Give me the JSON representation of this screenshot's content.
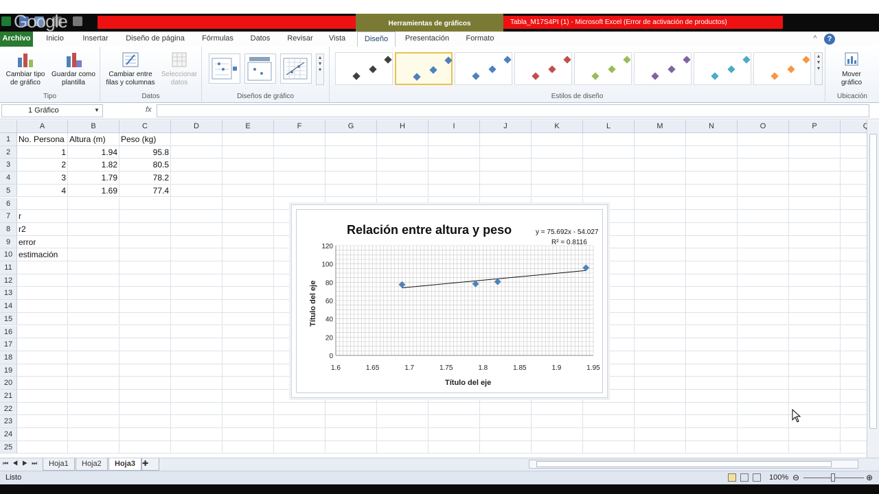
{
  "titlebar": {
    "tools_label": "Herramientas de gráficos",
    "window_title": "Tabla_M17S4PI (1)  -  Microsoft Excel (Error de activación de productos)",
    "overlay_logo": "Google"
  },
  "tabs": [
    "Archivo",
    "Inicio",
    "Insertar",
    "Diseño de página",
    "Fórmulas",
    "Datos",
    "Revisar",
    "Vista",
    "Diseño",
    "Presentación",
    "Formato"
  ],
  "ribbon": {
    "tipo": {
      "label": "Tipo",
      "btn1": "Cambiar tipo\nde gráfico",
      "btn2": "Guardar como\nplantilla"
    },
    "datos": {
      "label": "Datos",
      "btn1": "Cambiar entre\nfilas y columnas",
      "btn2": "Seleccionar\ndatos"
    },
    "disenos_label": "Diseños de gráfico",
    "estilos_label": "Estilos de diseño",
    "ubicacion": {
      "label": "Ubicación",
      "btn": "Mover\ngráfico"
    },
    "style_colors": [
      "#404040",
      "#4f81bd",
      "#4f81bd",
      "#c0504d",
      "#9bbb59",
      "#8064a2",
      "#4bacc6",
      "#f79646"
    ]
  },
  "formula_bar": {
    "name_box": "1 Gráfico",
    "fx": "fx",
    "formula": ""
  },
  "columns": [
    "A",
    "B",
    "C",
    "D",
    "E",
    "F",
    "G",
    "H",
    "I",
    "J",
    "K",
    "L",
    "M",
    "N",
    "O",
    "P",
    "Q"
  ],
  "rows": [
    "1",
    "2",
    "3",
    "4",
    "5",
    "6",
    "7",
    "8",
    "9",
    "10",
    "11",
    "12",
    "13",
    "14",
    "15",
    "16",
    "17",
    "18",
    "19",
    "20",
    "21",
    "22",
    "23",
    "24",
    "25"
  ],
  "cells": {
    "headers": [
      "No. Persona",
      "Altura (m)",
      "Peso (kg)"
    ],
    "data": [
      [
        "1",
        "1.94",
        "95.8"
      ],
      [
        "2",
        "1.82",
        "80.5"
      ],
      [
        "3",
        "1.79",
        "78.2"
      ],
      [
        "4",
        "1.69",
        "77.4"
      ]
    ],
    "labels": [
      "r",
      "r2",
      "error",
      "estimación"
    ]
  },
  "chart_data": {
    "type": "scatter",
    "title": "Relación entre altura y peso",
    "xlabel": "Título del eje",
    "ylabel": "Título del eje",
    "x": [
      1.94,
      1.82,
      1.79,
      1.69
    ],
    "y": [
      95.8,
      80.5,
      78.2,
      77.4
    ],
    "xlim": [
      1.6,
      1.95
    ],
    "ylim": [
      0,
      120
    ],
    "xticks": [
      "1.6",
      "1.65",
      "1.7",
      "1.75",
      "1.8",
      "1.85",
      "1.9",
      "1.95"
    ],
    "yticks": [
      "0",
      "20",
      "40",
      "60",
      "80",
      "100",
      "120"
    ],
    "trendline": {
      "slope": 75.692,
      "intercept": -54.027,
      "equation": "y = 75.692x - 54.027",
      "r2": "R² = 0.8116"
    },
    "grid": true,
    "marker_color": "#4f81bd",
    "line_color": "#111111"
  },
  "sheets": [
    "Hoja1",
    "Hoja2",
    "Hoja3"
  ],
  "active_sheet": "Hoja3",
  "status": {
    "mode": "Listo",
    "zoom": "100%"
  }
}
